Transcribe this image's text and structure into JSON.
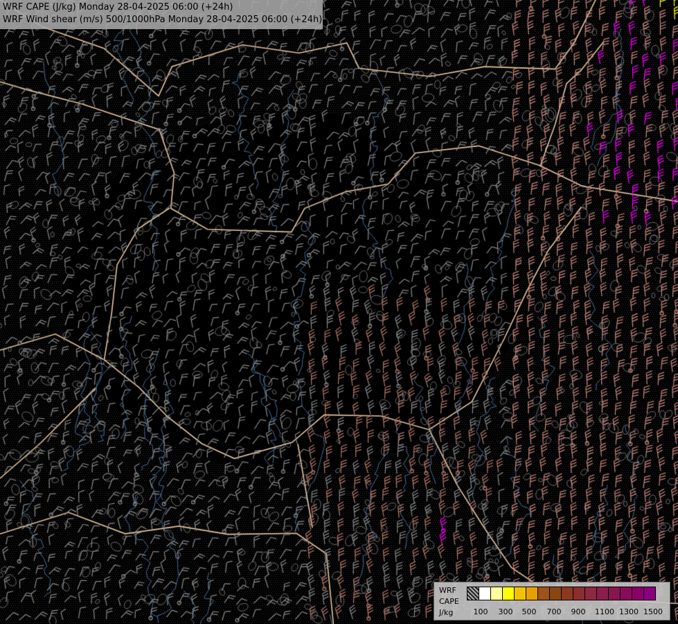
{
  "header": {
    "line1": "WRF CAPE (J/kg) Monday 28-04-2025 06:00 (+24h)",
    "line2": "WRF Wind shear (m/s) 500/1000hPa Monday 28-04-2025 06:00 (+24h)"
  },
  "legend": {
    "model": "WRF",
    "variable": "CAPE",
    "unit": "J/kg",
    "colors": [
      "hatched",
      "#ffffff",
      "#ffff99",
      "#ffff00",
      "#f2c200",
      "#e8a000",
      "#a0521a",
      "#8b4513",
      "#8b3a20",
      "#8b2e2e",
      "#8e2840",
      "#8b1e4a",
      "#8a1450",
      "#8b0a5a",
      "#8b0068",
      "#8b0080"
    ],
    "tick_labels": [
      "100",
      "300",
      "500",
      "700",
      "900",
      "1100",
      "1300",
      "1500"
    ]
  },
  "map": {
    "background": "#000000",
    "border_color": "#e8c7a0",
    "river_color": "#4a6f9a",
    "contour_color": "#9a9a9a",
    "barb_colors": [
      "#8c8c8c",
      "#b57b6e",
      "#c98a80",
      "#ff00ff",
      "#ffff00"
    ]
  }
}
